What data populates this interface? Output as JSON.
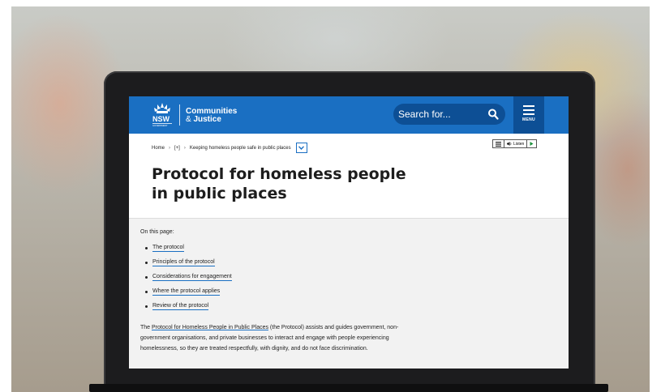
{
  "header": {
    "logo_text": "NSW",
    "logo_subtext": "GOVERNMENT",
    "brand_line1": "Communities",
    "brand_amp": "& ",
    "brand_line2": "Justice",
    "search_placeholder": "Search for...",
    "menu_label": "MENU"
  },
  "breadcrumb": {
    "home": "Home",
    "sep1": "›",
    "collapsed": "[+]",
    "sep2": "›",
    "current": "Keeping homeless people safe in public places"
  },
  "listen": {
    "label": "Listen"
  },
  "page": {
    "title": "Protocol for homeless people in public places"
  },
  "content": {
    "on_this_page": "On this page:",
    "toc": [
      "The protocol",
      "Principles of the protocol",
      "Considerations for engagement",
      "Where the protocol applies",
      "Review of the protocol"
    ],
    "intro_link": "Protocol for Homeless People in Public Places",
    "intro_pre": "The ",
    "intro_post": " (the Protocol) assists and guides government, non-government organisations, and private businesses to interact and engage with people experiencing homelessness, so they are treated respectfully, with dignity, and do not face discrimination."
  },
  "colors": {
    "header_blue": "#1a6fc2",
    "header_dark": "#0d4f95",
    "content_bg": "#f2f2f2"
  }
}
